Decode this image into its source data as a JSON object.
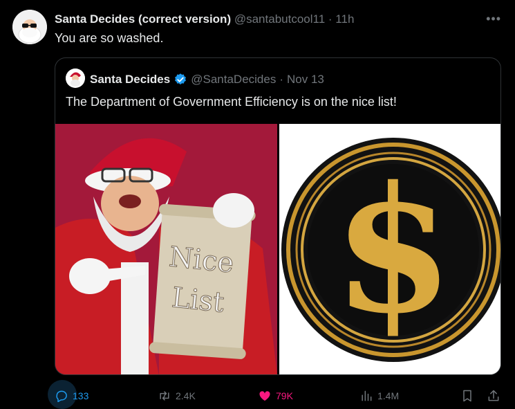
{
  "tweet": {
    "display_name": "Santa Decides (correct version)",
    "handle": "@santabutcool11",
    "separator": "·",
    "time": "11h",
    "text": "You are so washed."
  },
  "quoted": {
    "display_name": "Santa Decides",
    "handle": "@SantaDecides",
    "separator": "·",
    "time": "Nov 13",
    "text": "The Department of Government Efficiency is on the nice list!",
    "scroll_text_line1": "Nice",
    "scroll_text_line2": "List"
  },
  "actions": {
    "reply_count": "133",
    "repost_count": "2.4K",
    "like_count": "79K",
    "views_count": "1.4M"
  },
  "colors": {
    "background": "#000000",
    "text": "#e7e9ea",
    "muted": "#71767b",
    "reply_active": "#1d9bf0",
    "like_active": "#f91880",
    "verified": "#1d9bf0"
  },
  "icons": {
    "more": "more-icon",
    "verified": "verified-badge-icon",
    "reply": "reply-icon",
    "repost": "repost-icon",
    "like": "heart-icon",
    "views": "views-icon",
    "bookmark": "bookmark-icon",
    "share": "share-icon"
  }
}
